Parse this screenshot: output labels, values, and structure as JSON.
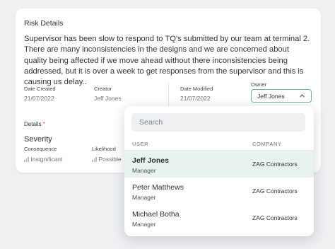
{
  "risk": {
    "title": "Risk Details",
    "description": "Supervisor has been slow to respond to TQ's submitted by our team at terminal 2. There are many inconsistencies in the designs and we are concerned about quality being affected if we move ahead without there inconsistencies being addressed, but it is over a week to get responses from the supervisor and this is causing us delay..",
    "date_created_label": "Date Created",
    "date_created": "21/07/2022",
    "creator_label": "Creator",
    "creator": "Jeff Jones",
    "date_modified_label": "Date Modified",
    "date_modified": "21/07/2022",
    "owner_label": "Owner",
    "owner_value": "Jeff Jones",
    "details_label": "Details",
    "required_marker": "*",
    "severity_title": "Severity",
    "consequence_label": "Consequence",
    "consequence_value": "Insignificant",
    "likelihood_label": "Likelihood",
    "likelihood_value": "Possible"
  },
  "dropdown": {
    "search_placeholder": "Search",
    "col_user": "USER",
    "col_company": "COMPANY",
    "rows": [
      {
        "name": "Jeff Jones",
        "role": "Manager",
        "company": "ZAG Contractors",
        "selected": true
      },
      {
        "name": "Peter Matthews",
        "role": "Manager",
        "company": "ZAG Contractors",
        "selected": false
      },
      {
        "name": "Michael Botha",
        "role": "Manager",
        "company": "ZAG Contractors",
        "selected": false
      }
    ]
  },
  "colors": {
    "accent_border": "#6fb79a",
    "selected_row_bg": "#e8f3ee",
    "required": "#e04747"
  },
  "icons": {
    "owner_toggle": "chevron-up-icon",
    "level_indicator": "signal-bars-icon"
  }
}
